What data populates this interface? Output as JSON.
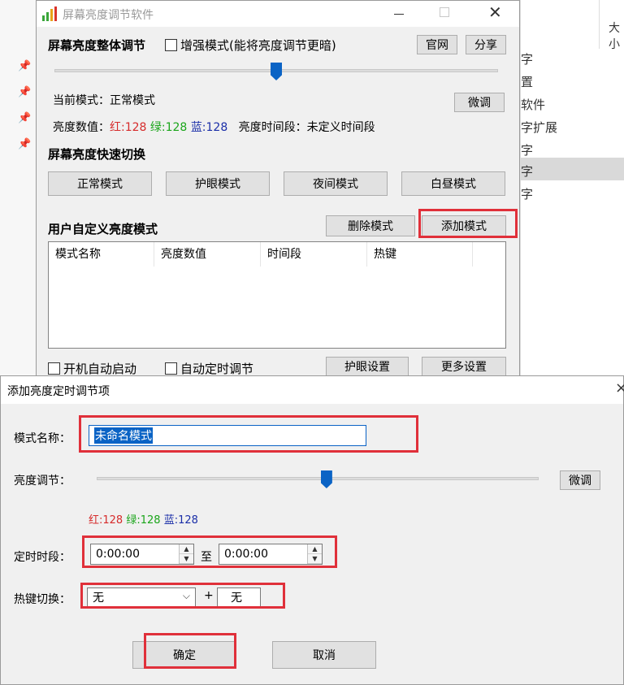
{
  "background_window": {
    "header_fragment": "大小",
    "items": [
      "字",
      "置",
      "软件",
      "字扩展",
      "字",
      "字",
      "字"
    ]
  },
  "main_window": {
    "title": "屏幕亮度调节软件",
    "overall": {
      "heading": "屏幕亮度整体调节",
      "enhance_label": "增强模式(能将亮度调节更暗)",
      "official_label": "官网",
      "share_label": "分享",
      "brightness": 0.5
    },
    "current_mode_label": "当前模式：",
    "current_mode_value": "正常模式",
    "fine_tune_label": "微调",
    "values_label": "亮度数值：",
    "red_label": "红:128",
    "green_label": "绿:128",
    "blue_label": "蓝:128",
    "period_label": "亮度时间段：",
    "period_value": "未定义时间段",
    "quick_heading": "屏幕亮度快速切换",
    "quick_modes": [
      "正常模式",
      "护眼模式",
      "夜间模式",
      "白昼模式"
    ],
    "custom_heading": "用户自定义亮度模式",
    "delete_label": "删除模式",
    "add_label": "添加模式",
    "columns": [
      "模式名称",
      "亮度数值",
      "时间段",
      "热键"
    ],
    "autostart_label": "开机自动启动",
    "autotimer_label": "自动定时调节",
    "eye_settings_label": "护眼设置",
    "more_settings_label": "更多设置"
  },
  "dialog": {
    "title": "添加亮度定时调节项",
    "close_glyph": "×",
    "name_label": "模式名称：",
    "name_value": "未命名模式",
    "brightness_label": "亮度调节：",
    "brightness": 0.52,
    "fine_tune_label": "微调",
    "red_label": "红:128",
    "green_label": "绿:128",
    "blue_label": "蓝:128",
    "timer_label": "定时时段：",
    "start_time": "0:00:00",
    "to_label": "至",
    "end_time": "0:00:00",
    "hotkey_label": "热键切换：",
    "hotkey_modifier": "无",
    "plus_label": "+",
    "hotkey_key": "无",
    "ok_label": "确定",
    "cancel_label": "取消"
  },
  "colors": {
    "accent": "#0a63c5",
    "highlight_box": "#e0303a",
    "red_value": "#d62b2b",
    "green_value": "#1aa51a",
    "blue_value": "#1a2ea8"
  }
}
